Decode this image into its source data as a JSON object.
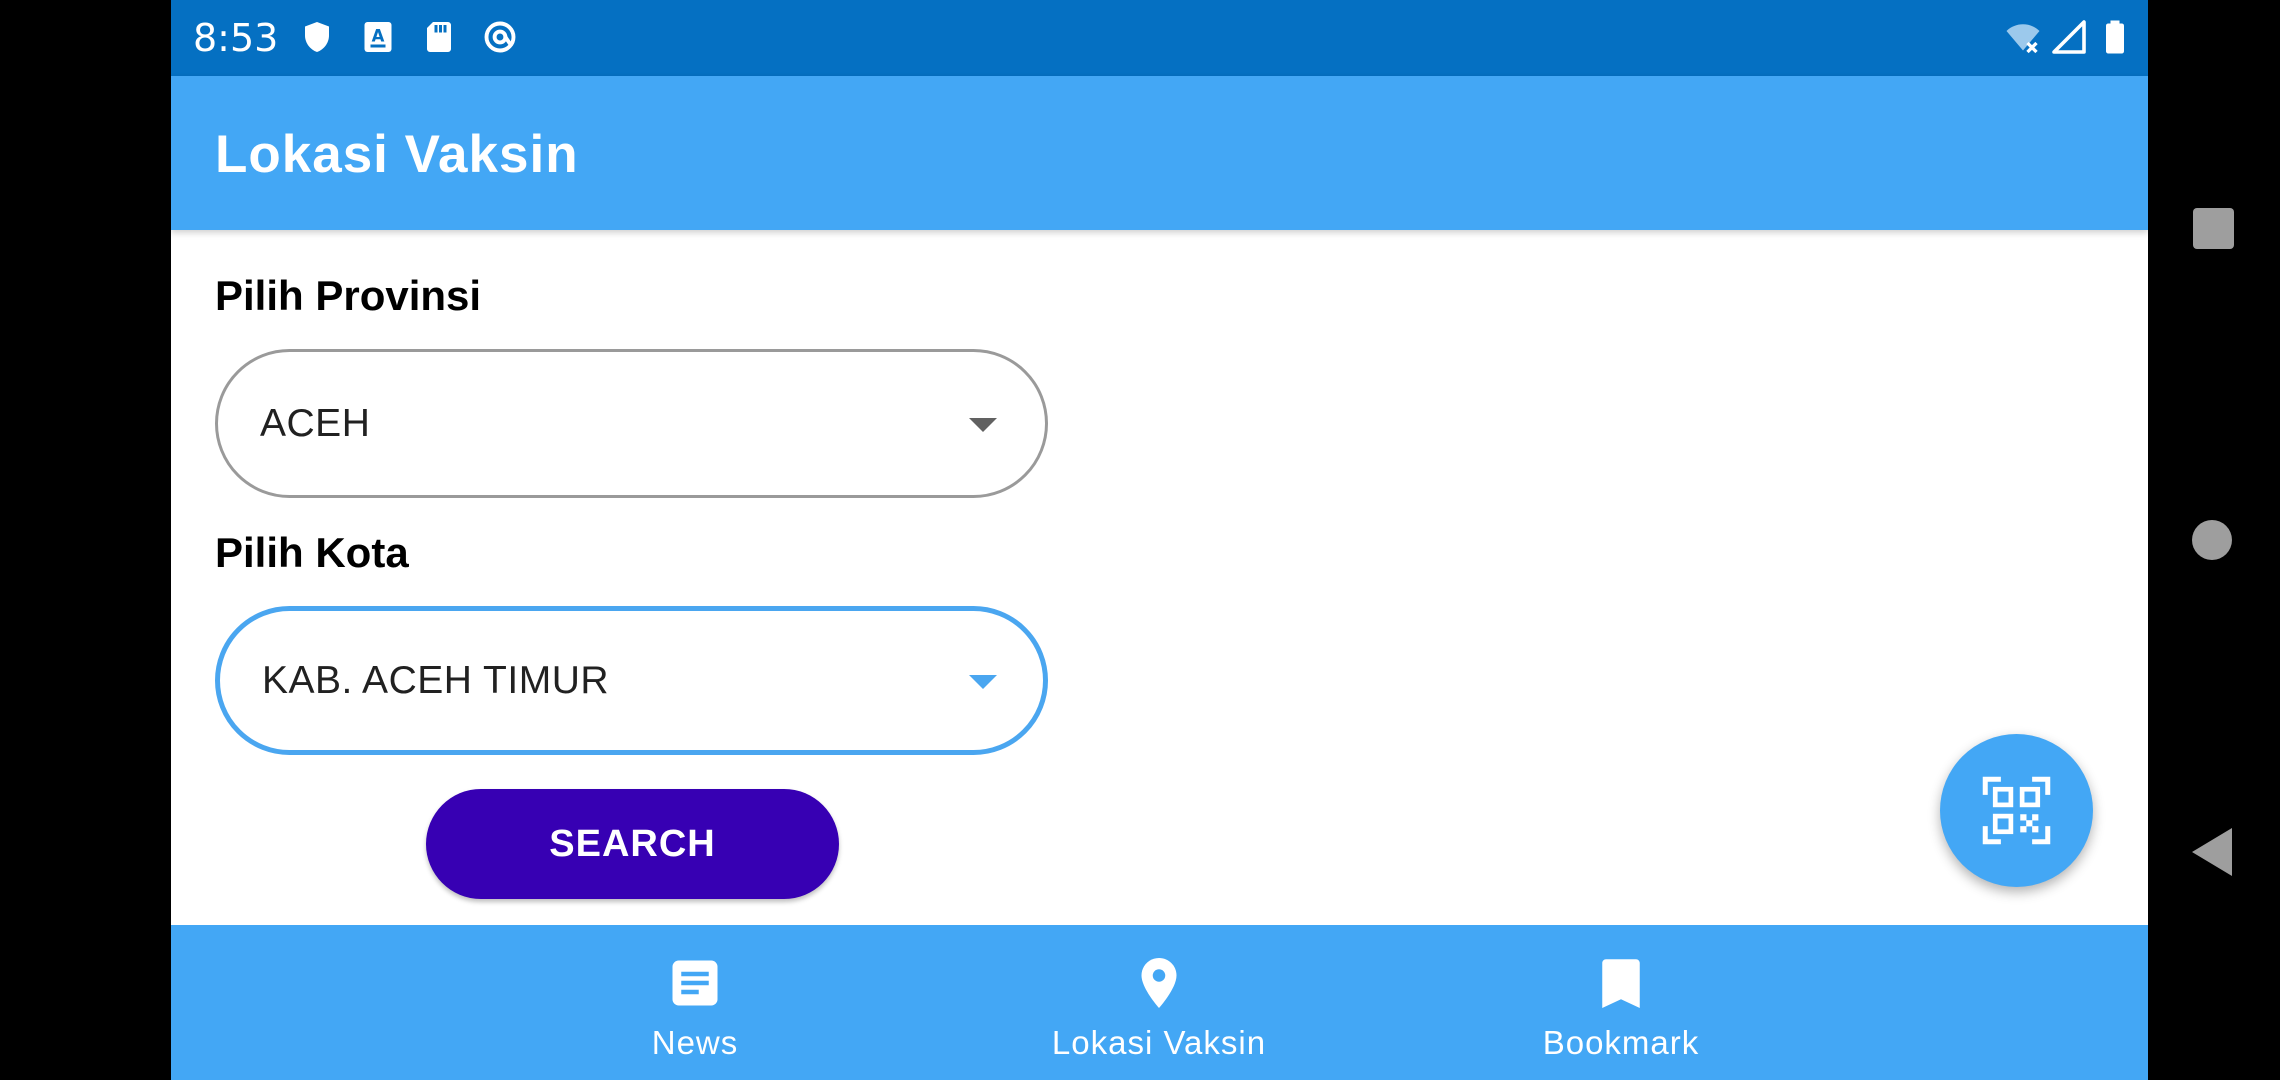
{
  "status_bar": {
    "time": "8:53",
    "left_icons": [
      "shield-icon",
      "keyboard-a-icon",
      "sd-card-icon",
      "at-sync-icon"
    ],
    "right_icons": [
      "wifi-off-icon",
      "cell-signal-icon",
      "battery-icon"
    ]
  },
  "app_bar": {
    "title": "Lokasi Vaksin"
  },
  "form": {
    "provinsi_label": "Pilih Provinsi",
    "provinsi_value": "ACEH",
    "kota_label": "Pilih Kota",
    "kota_value": "KAB. ACEH TIMUR",
    "search_label": "SEARCH"
  },
  "fab": {
    "icon": "qr-scan-icon"
  },
  "bottom_nav": {
    "items": [
      {
        "label": "News",
        "icon": "article-icon"
      },
      {
        "label": "Lokasi Vaksin",
        "icon": "location-pin-icon"
      },
      {
        "label": "Bookmark",
        "icon": "bookmark-icon"
      }
    ]
  },
  "colors": {
    "status_bar": "#0570c2",
    "primary": "#43a7f5",
    "search_button": "#3700b3",
    "focused_outline": "#4aa6f0"
  }
}
